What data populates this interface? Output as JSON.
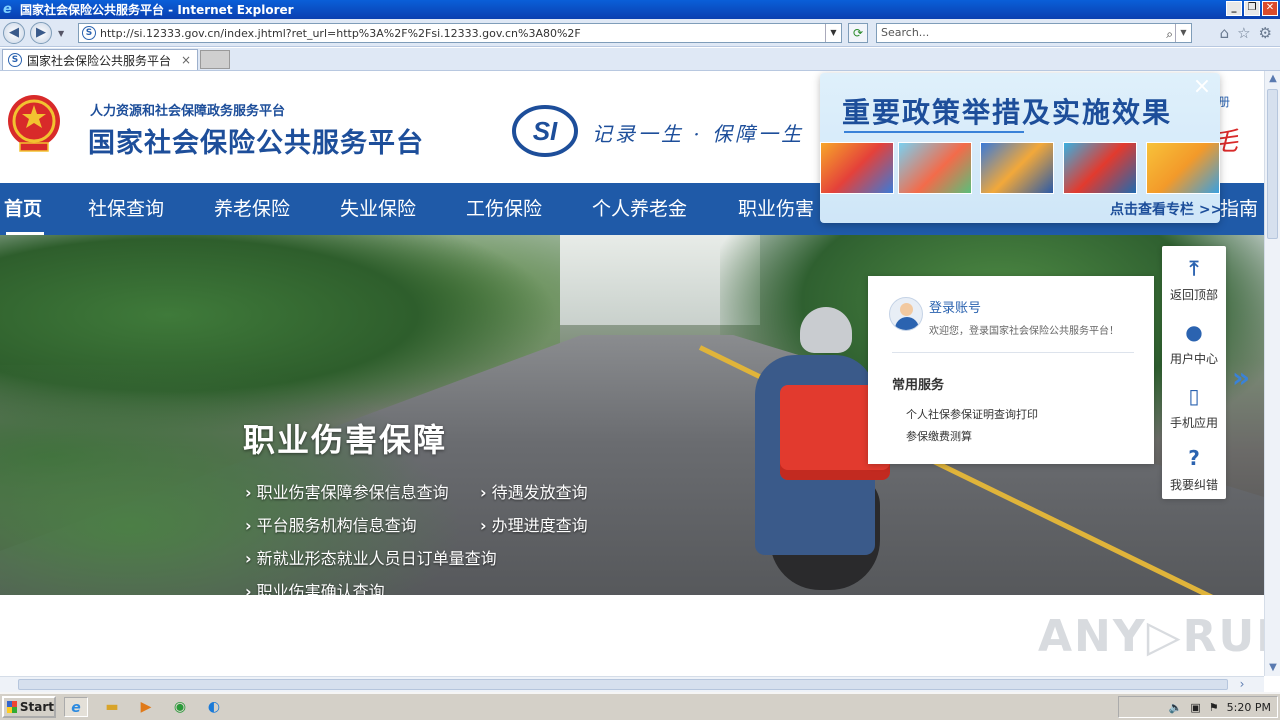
{
  "window": {
    "title": "国家社会保险公共服务平台 - Internet Explorer",
    "minimize": "_",
    "restore": "❐",
    "close": "✕"
  },
  "browser": {
    "back_icon": "back-arrow-icon",
    "forward_icon": "forward-arrow-icon",
    "address": "http://si.12333.gov.cn/index.jhtml?ret_url=http%3A%2F%2Fsi.12333.gov.cn%3A80%2F",
    "search_placeholder": "Search...",
    "tab_title": "国家社会保险公共服务平台",
    "tab_close": "×"
  },
  "header": {
    "subtitle": "人力资源和社会保障政务服务平台",
    "title": "国家社会保险公共服务平台",
    "slogan": "记录一生 · 保障一生",
    "register_link": "册",
    "logo_text": "SI"
  },
  "nav": {
    "items": [
      {
        "label": "首页",
        "active": true
      },
      {
        "label": "社保查询"
      },
      {
        "label": "养老保险"
      },
      {
        "label": "失业保险"
      },
      {
        "label": "工伤保险"
      },
      {
        "label": "个人养老金"
      },
      {
        "label": "职业伤害"
      },
      {
        "label": "指南"
      }
    ]
  },
  "banner": {
    "title": "职业伤害保障",
    "links": [
      "职业伤害保障参保信息查询",
      "待遇发放查询",
      "平台服务机构信息查询",
      "办理进度查询",
      "新就业形态就业人员日订单量查询",
      "职业伤害确认查询"
    ]
  },
  "login_card": {
    "title": "登录账号",
    "welcome": "欢迎您，登录国家社会保险公共服务平台！",
    "services_title": "常用服务",
    "services": [
      "个人社保参保证明查询打印",
      "参保缴费测算"
    ]
  },
  "side_tools": [
    {
      "label": "返回顶部",
      "icon": "arrow-up-icon"
    },
    {
      "label": "用户中心",
      "icon": "user-icon"
    },
    {
      "label": "手机应用",
      "icon": "phone-icon"
    },
    {
      "label": "我要纠错",
      "icon": "question-icon"
    }
  ],
  "popup": {
    "title": "重要政策举措及实施效果",
    "link": "点击查看专栏 >>",
    "close": "×"
  },
  "watermark": "ANY▷RUN",
  "taskbar": {
    "start": "Start",
    "time": "5:20 PM"
  },
  "colors": {
    "brand_blue": "#1f5aa8",
    "title_blue": "#1d4e9a",
    "link_blue": "#2b63b0"
  }
}
